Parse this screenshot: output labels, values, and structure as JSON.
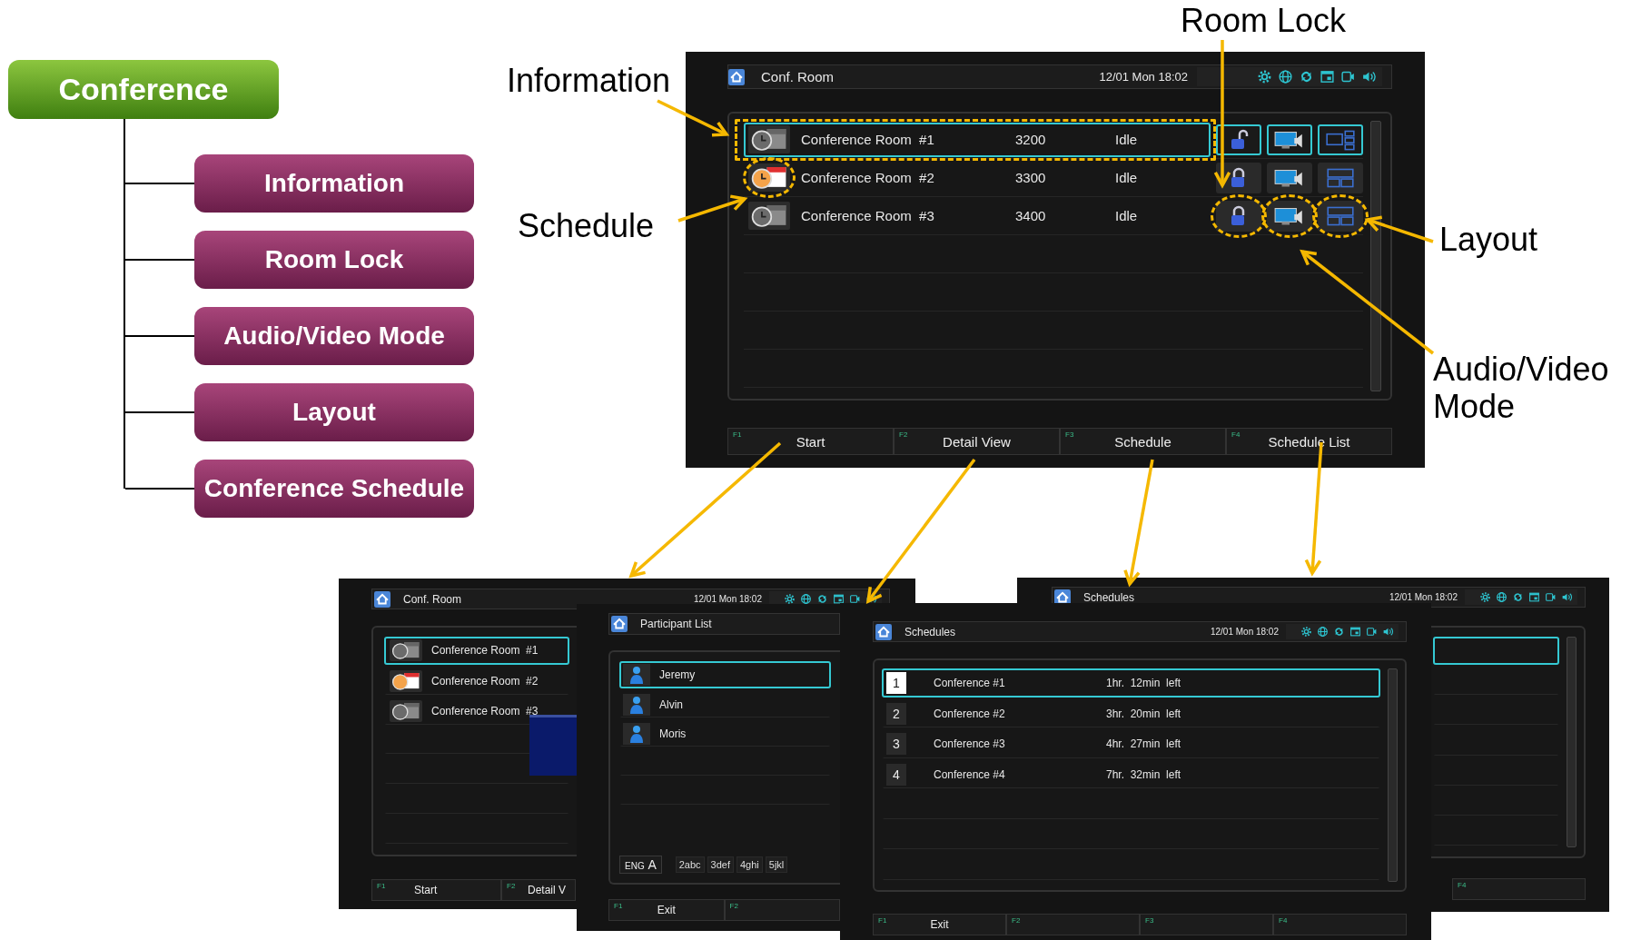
{
  "tree": {
    "root": "Conference",
    "children": [
      {
        "label": "Information"
      },
      {
        "label": "Room Lock"
      },
      {
        "label": "Audio/Video Mode"
      },
      {
        "label": "Layout"
      },
      {
        "label": "Conference Schedule"
      }
    ]
  },
  "callouts": [
    {
      "label": "Information"
    },
    {
      "label": "Room Lock"
    },
    {
      "label": "Schedule"
    },
    {
      "label": "Layout"
    },
    {
      "label": "Audio/Video Mode"
    }
  ],
  "main_screen": {
    "title": "Conf. Room",
    "datetime": "12/01 Mon 18:02",
    "rooms": [
      {
        "name": "Conference Room  #1",
        "number": "3200",
        "status": "Idle",
        "selected": true,
        "scheduled": false,
        "locked": false,
        "info_circled": true,
        "schedule_circled": false,
        "lock_circled": false,
        "av_circled": false,
        "layout_circled": false
      },
      {
        "name": "Conference Room  #2",
        "number": "3300",
        "status": "Idle",
        "selected": false,
        "scheduled": true,
        "locked": true,
        "info_circled": false,
        "schedule_circled": true,
        "lock_circled": false,
        "av_circled": false,
        "layout_circled": false
      },
      {
        "name": "Conference Room  #3",
        "number": "3400",
        "status": "Idle",
        "selected": false,
        "scheduled": false,
        "locked": true,
        "info_circled": false,
        "schedule_circled": false,
        "lock_circled": true,
        "av_circled": true,
        "layout_circled": true
      }
    ],
    "function_keys": [
      {
        "key": "F1",
        "label": "Start"
      },
      {
        "key": "F2",
        "label": "Detail View"
      },
      {
        "key": "F3",
        "label": "Schedule"
      },
      {
        "key": "F4",
        "label": "Schedule List"
      }
    ]
  },
  "room_screen": {
    "title": "Conf. Room",
    "datetime": "12/01 Mon 18:02",
    "rooms": [
      {
        "name": "Conference Room  #1",
        "selected": true,
        "scheduled": false
      },
      {
        "name": "Conference Room  #2",
        "selected": false,
        "scheduled": true
      },
      {
        "name": "Conference Room  #3",
        "selected": false,
        "scheduled": false
      }
    ],
    "function_keys": [
      {
        "key": "F1",
        "label": "Start"
      },
      {
        "key": "F2",
        "label": "Detail V"
      }
    ]
  },
  "participant_screen": {
    "title": "Participant List",
    "participants": [
      {
        "name": "Jeremy",
        "selected": true
      },
      {
        "name": "Alvin",
        "selected": false
      },
      {
        "name": "Moris",
        "selected": false
      }
    ],
    "input_mode": {
      "language": "ENG",
      "letter": "A"
    },
    "keys": [
      "2abc",
      "3def",
      "4ghi",
      "5jkl"
    ],
    "function_keys": [
      {
        "key": "F1",
        "label": "Exit"
      },
      {
        "key": "F2"
      }
    ]
  },
  "schedule_list_screen": {
    "title": "Schedules",
    "datetime": "12/01 Mon 18:02",
    "function_keys": [
      {
        "key": "F4"
      }
    ]
  },
  "schedule_screen": {
    "title": "Schedules",
    "datetime": "12/01 Mon 18:02",
    "schedules": [
      {
        "index": "1",
        "name": "Conference #1",
        "remaining": "1hr.  12min  left",
        "selected": true
      },
      {
        "index": "2",
        "name": "Conference #2",
        "remaining": "3hr.  20min  left",
        "selected": false
      },
      {
        "index": "3",
        "name": "Conference #3",
        "remaining": "4hr.  27min  left",
        "selected": false
      },
      {
        "index": "4",
        "name": "Conference #4",
        "remaining": "7hr.  32min  left",
        "selected": false
      }
    ],
    "function_keys": [
      {
        "key": "F1",
        "label": "Exit"
      },
      {
        "key": "F2"
      },
      {
        "key": "F3"
      },
      {
        "key": "F4"
      }
    ]
  }
}
